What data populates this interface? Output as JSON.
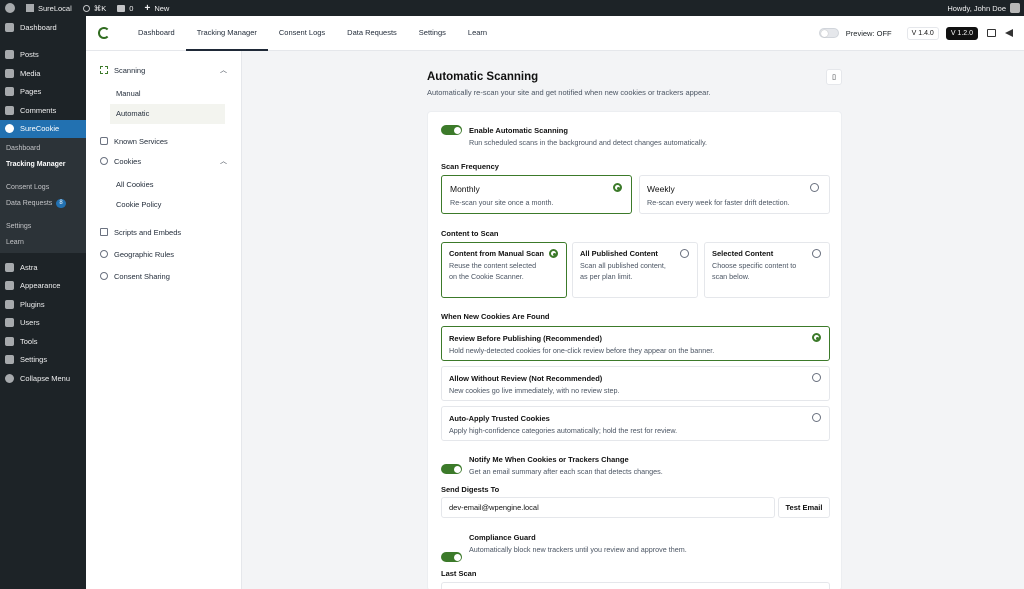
{
  "admin_bar": {
    "site_name": "SureLocal",
    "shortcut": "⌘K",
    "comments_count": "0",
    "new_label": "New",
    "greeting": "Howdy, John Doe"
  },
  "wp_menu": {
    "dashboard": "Dashboard",
    "posts": "Posts",
    "media": "Media",
    "pages": "Pages",
    "comments": "Comments",
    "surecookie": "SureCookie",
    "sub": {
      "dashboard": "Dashboard",
      "tracking_manager": "Tracking Manager",
      "consent_logs": "Consent Logs",
      "data_requests": "Data Requests",
      "data_requests_badge": "8",
      "settings": "Settings",
      "learn": "Learn"
    },
    "astra": "Astra",
    "appearance": "Appearance",
    "plugins": "Plugins",
    "users": "Users",
    "tools": "Tools",
    "settings": "Settings",
    "collapse": "Collapse Menu"
  },
  "top_nav": {
    "tabs": [
      "Dashboard",
      "Tracking Manager",
      "Consent Logs",
      "Data Requests",
      "Settings",
      "Learn"
    ],
    "active_tab": "Tracking Manager",
    "preview_label": "Preview: OFF",
    "version_1": "V 1.4.0",
    "version_2": "V 1.2.0"
  },
  "plugin_menu": {
    "scanning": "Scanning",
    "manual": "Manual",
    "automatic": "Automatic",
    "known_services": "Known Services",
    "cookies": "Cookies",
    "all_cookies": "All Cookies",
    "cookie_policy": "Cookie Policy",
    "scripts_embeds": "Scripts and Embeds",
    "geographic_rules": "Geographic Rules",
    "consent_sharing": "Consent Sharing"
  },
  "page": {
    "title": "Automatic Scanning",
    "subtitle": "Automatically re-scan your site and get notified when new cookies or trackers appear.",
    "enable": {
      "label": "Enable Automatic Scanning",
      "desc": "Run scheduled scans in the background and detect changes automatically.",
      "on": true
    },
    "frequency": {
      "label": "Scan Frequency",
      "options": [
        {
          "title": "Monthly",
          "desc": "Re-scan your site once a month.",
          "selected": true
        },
        {
          "title": "Weekly",
          "desc": "Re-scan every week for faster drift detection.",
          "selected": false
        }
      ]
    },
    "content": {
      "label": "Content to Scan",
      "options": [
        {
          "title": "Content from Manual Scan",
          "desc": "Reuse the content selected on the Cookie Scanner.",
          "selected": true
        },
        {
          "title": "All Published Content",
          "desc": "Scan all published content, as per plan limit.",
          "selected": false
        },
        {
          "title": "Selected Content",
          "desc": "Choose specific content to scan below.",
          "selected": false
        }
      ]
    },
    "new_cookies": {
      "label": "When New Cookies Are Found",
      "options": [
        {
          "title": "Review Before Publishing (Recommended)",
          "desc": "Hold newly-detected cookies for one-click review before they appear on the banner.",
          "selected": true
        },
        {
          "title": "Allow Without Review (Not Recommended)",
          "desc": "New cookies go live immediately, with no review step.",
          "selected": false
        },
        {
          "title": "Auto-Apply Trusted Cookies",
          "desc": "Apply high-confidence categories automatically; hold the rest for review.",
          "selected": false
        }
      ]
    },
    "notify": {
      "label": "Notify Me When Cookies or Trackers Change",
      "desc": "Get an email summary after each scan that detects changes.",
      "on": true
    },
    "digest": {
      "label": "Send Digests To",
      "email": "dev-email@wpengine.local",
      "test_button": "Test Email"
    },
    "guard": {
      "label": "Compliance Guard",
      "desc": "Automatically block new trackers until you review and approve them.",
      "on": true
    },
    "last_scan_label": "Last Scan"
  },
  "colors": {
    "accent": "#3c7a2a",
    "wp_admin_bg": "#1d2327",
    "wp_active": "#2271b1"
  }
}
